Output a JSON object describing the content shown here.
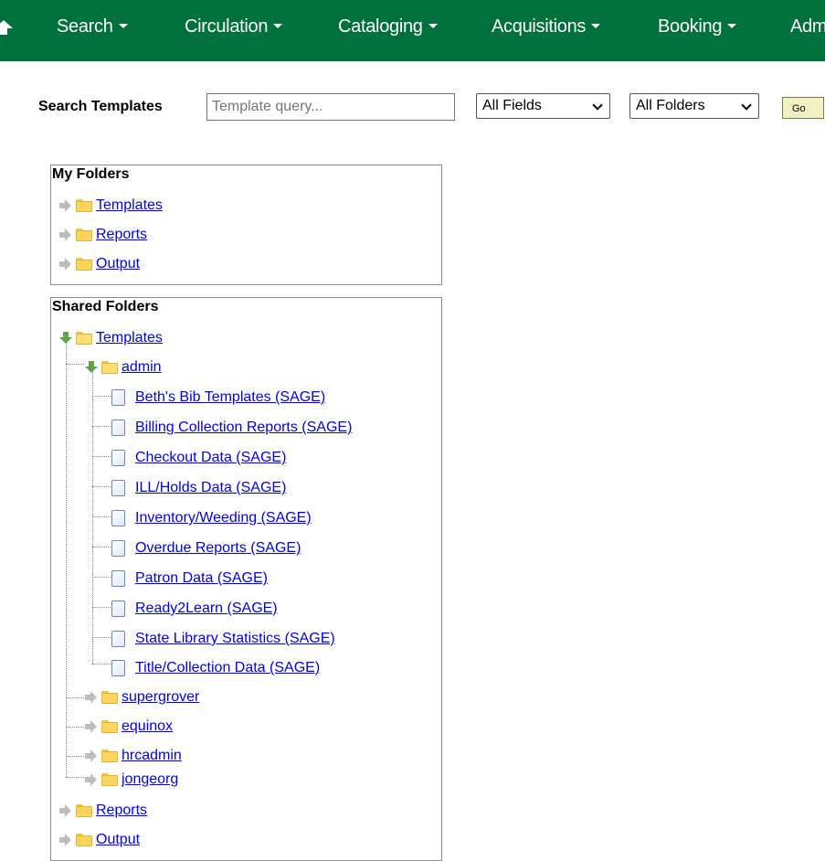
{
  "nav": {
    "items": [
      {
        "label": "Search"
      },
      {
        "label": "Circulation"
      },
      {
        "label": "Cataloging"
      },
      {
        "label": "Acquisitions"
      },
      {
        "label": "Booking"
      },
      {
        "label": "Adm"
      }
    ]
  },
  "search": {
    "label": "Search Templates",
    "placeholder": "Template query...",
    "field_select": "All Fields",
    "folder_select": "All Folders",
    "go_label": "Go"
  },
  "my_folders": {
    "title": "My Folders",
    "items": [
      {
        "label": "Templates"
      },
      {
        "label": "Reports"
      },
      {
        "label": "Output"
      }
    ]
  },
  "shared_folders": {
    "title": "Shared Folders",
    "templates_label": "Templates",
    "admin_label": "admin",
    "admin_items": [
      {
        "label": "Beth's Bib Templates (SAGE)"
      },
      {
        "label": "Billing Collection Reports (SAGE)"
      },
      {
        "label": "Checkout Data (SAGE)"
      },
      {
        "label": "ILL/Holds Data (SAGE)"
      },
      {
        "label": "Inventory/Weeding (SAGE)"
      },
      {
        "label": "Overdue Reports (SAGE)"
      },
      {
        "label": "Patron Data (SAGE)"
      },
      {
        "label": "Ready2Learn (SAGE)"
      },
      {
        "label": "State Library Statistics (SAGE)"
      },
      {
        "label": "Title/Collection Data (SAGE)"
      }
    ],
    "user_folders": [
      {
        "label": "supergrover"
      },
      {
        "label": "equinox"
      },
      {
        "label": "hrcadmin"
      },
      {
        "label": "jongeorg"
      }
    ],
    "reports_label": "Reports",
    "output_label": "Output"
  }
}
